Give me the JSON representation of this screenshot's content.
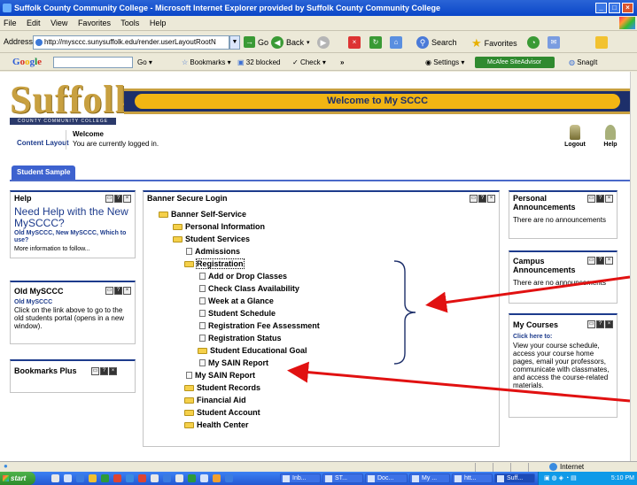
{
  "window": {
    "title": "Suffolk County Community College - Microsoft Internet Explorer provided by Suffolk County Community College",
    "buttons": [
      "_",
      "□",
      "×"
    ]
  },
  "menu": [
    "File",
    "Edit",
    "View",
    "Favorites",
    "Tools",
    "Help"
  ],
  "addressbar": {
    "label": "Address",
    "url": "http://mysccc.sunysuffolk.edu/render.userLayoutRootN",
    "go": "Go",
    "back": "Back",
    "search": "Search",
    "favorites": "Favorites"
  },
  "google_toolbar": {
    "logo": [
      "G",
      "o",
      "o",
      "g",
      "l",
      "e"
    ],
    "go_label": "Go",
    "bookmarks": "Bookmarks",
    "blocked": "32 blocked",
    "check": "Check",
    "more": "»",
    "settings": "Settings",
    "mcafee": "McAfee SiteAdvisor",
    "snagit": "SnagIt"
  },
  "portal": {
    "logo_text": "Suffolk",
    "logo_subtitle": "COUNTY COMMUNITY COLLEGE",
    "welcome_banner": "Welcome to My SCCC",
    "content_layout": "Content Layout",
    "welcome_title": "Welcome",
    "welcome_message": "You are currently logged in.",
    "logout": "Logout",
    "help": "Help",
    "tab": "Student Sample"
  },
  "help_box": {
    "title": "Help",
    "headline": "Need Help with the New MySCCC?",
    "link": "Old MySCCC, New MySCCC, Which to use?",
    "more": "More information to follow..."
  },
  "old_box": {
    "title": "Old MySCCC",
    "link": "Old MySCCC",
    "text": "Click on the link above to go to the old students portal (opens in a new window)."
  },
  "bookmarks_box": {
    "title": "Bookmarks Plus"
  },
  "banner_box": {
    "title": "Banner Secure Login",
    "tree": [
      {
        "label": "Banner Self-Service",
        "icon": "folder-open"
      },
      {
        "label": "Personal Information",
        "icon": "folder"
      },
      {
        "label": "Student Services",
        "icon": "folder-open"
      },
      {
        "label": "Admissions",
        "icon": "doc"
      },
      {
        "label": "Registration",
        "icon": "folder-open"
      },
      {
        "label": "Add or Drop Classes",
        "icon": "doc"
      },
      {
        "label": "Check Class Availability",
        "icon": "doc"
      },
      {
        "label": "Week at a Glance",
        "icon": "doc"
      },
      {
        "label": "Student Schedule",
        "icon": "doc"
      },
      {
        "label": "Registration Fee Assessment",
        "icon": "doc"
      },
      {
        "label": "Registration Status",
        "icon": "doc"
      },
      {
        "label": "Student Educational Goal",
        "icon": "folder"
      },
      {
        "label": "My SAIN Report",
        "icon": "doc"
      },
      {
        "label": "My SAIN Report",
        "icon": "doc"
      },
      {
        "label": "Student Records",
        "icon": "folder"
      },
      {
        "label": "Financial Aid",
        "icon": "folder"
      },
      {
        "label": "Student Account",
        "icon": "folder"
      },
      {
        "label": "Health Center",
        "icon": "folder"
      }
    ]
  },
  "personal_box": {
    "title": "Personal Announcements",
    "text": "There are no announcements"
  },
  "campus_box": {
    "title": "Campus Announcements",
    "text": "There are no announcements"
  },
  "courses_box": {
    "title": "My Courses",
    "link": "Click here to:",
    "text": "View your course schedule, access your course home pages, email your professors, communicate with classmates, and access the course-related materials."
  },
  "statusbar": {
    "zone": "Internet"
  },
  "taskbar": {
    "start": "start",
    "buttons": [
      "Inb...",
      "ST...",
      "Doc...",
      "My ...",
      "htt...",
      "Suff..."
    ],
    "clock": "5:10 PM"
  },
  "colors": {
    "banner_navy": "#1d2f6a",
    "banner_gold": "#f2b513",
    "link_blue": "#1d3b8c",
    "annotation_red": "#e11111"
  }
}
